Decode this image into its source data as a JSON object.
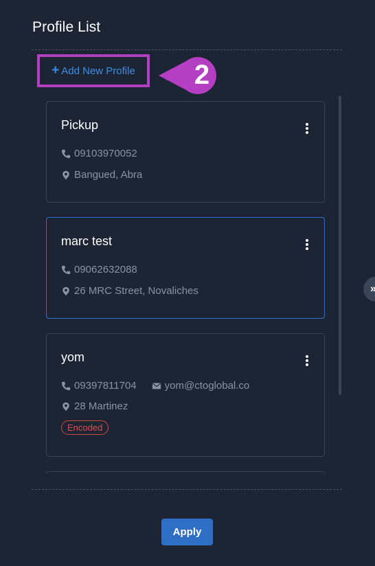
{
  "header": {
    "title": "Profile List"
  },
  "add_profile": {
    "icon": "plus-icon",
    "label": "Add New Profile"
  },
  "callout": {
    "number": "2",
    "color": "#b53fc3"
  },
  "profiles": [
    {
      "name": "Pickup",
      "phone": "09103970052",
      "address": "Bangued, Abra",
      "email": "",
      "badge": "",
      "selected": false
    },
    {
      "name": "marc test",
      "phone": "09062632088",
      "address": "26 MRC Street, Novaliches",
      "email": "",
      "badge": "",
      "selected": true
    },
    {
      "name": "yom",
      "phone": "09397811704",
      "email": "yom@ctoglobal.co",
      "address": "28 Martinez",
      "badge": "Encoded",
      "selected": false
    }
  ],
  "icons": {
    "phone": "phone-icon",
    "location": "map-marker-icon",
    "email": "envelope-icon",
    "menu": "kebab-menu-icon"
  },
  "side_toggle": {
    "label": "»"
  },
  "footer": {
    "apply_label": "Apply"
  },
  "colors": {
    "background": "#1d2535",
    "accent": "#2e6fc5",
    "link": "#3b8fe6",
    "selected_border": "#2c6ecd",
    "badge": "#e04c4c",
    "highlight": "#b53fc3"
  }
}
